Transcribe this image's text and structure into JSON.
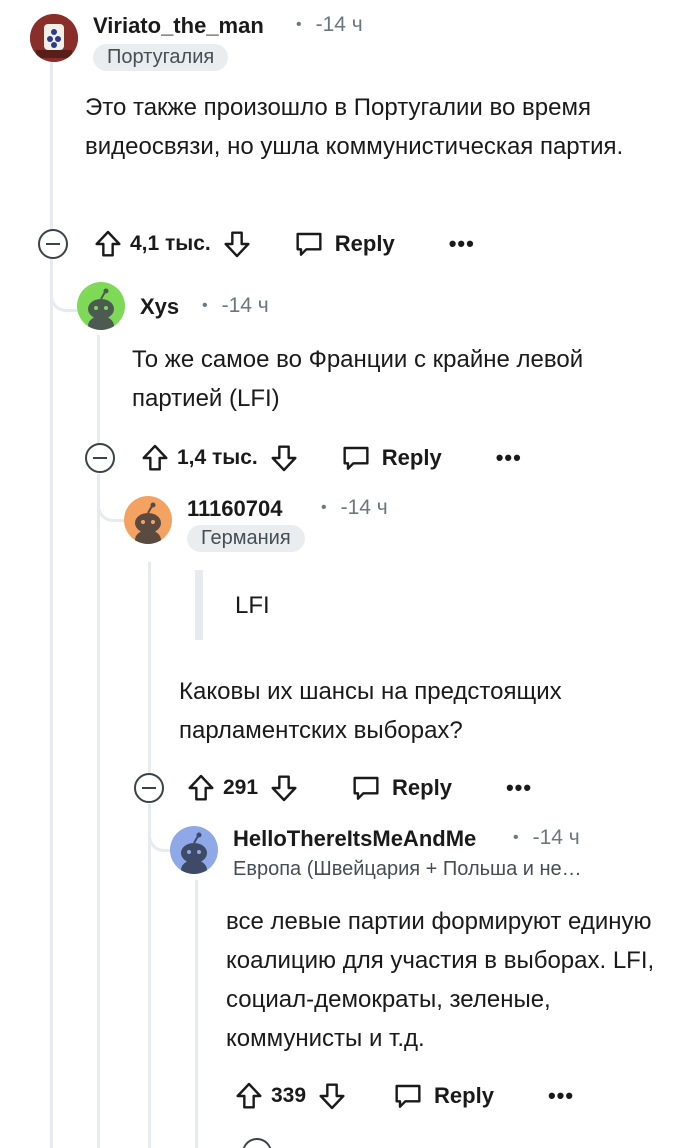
{
  "icons": {
    "upvote": "arrow-up-outline",
    "downvote": "arrow-down-outline",
    "reply": "speech-bubble",
    "more": "ellipsis",
    "collapse": "minus-circle"
  },
  "colors": {
    "thread_line": "#e5ebee",
    "meta_text": "#6b7780",
    "flair_bg": "#eaedef",
    "avatar_green": "#7ed957",
    "avatar_orange": "#f4a261",
    "avatar_blue": "#8fa8e8"
  },
  "comments": [
    {
      "username": "Viriato_the_man",
      "time": "-14 ч",
      "flair": "Португалия",
      "body": "Это также произошло в Португалии во время видеосвязи, но ушла коммунистическая партия.",
      "score": "4,1 тыс.",
      "reply_label": "Reply",
      "more_label": "•••"
    },
    {
      "username": "Xys",
      "time": "-14 ч",
      "body": "То же самое во Франции с крайне левой партией (LFI)",
      "score": "1,4 тыс.",
      "reply_label": "Reply",
      "more_label": "•••"
    },
    {
      "username": "11160704",
      "time": "-14 ч",
      "flair": "Германия",
      "quote": "LFI",
      "body": "Каковы их шансы на предстоящих парламентских выборах?",
      "score": "291",
      "reply_label": "Reply",
      "more_label": "•••"
    },
    {
      "username": "HelloThereItsMeAndMe",
      "time": "-14 ч",
      "flair": "Европа (Швейцария + Польша и не…",
      "body": "все левые партии формируют единую коалицию для участия в выборах. LFI, социал-демократы, зеленые, коммунисты и т.д.",
      "score": "339",
      "reply_label": "Reply",
      "more_label": "•••"
    }
  ]
}
